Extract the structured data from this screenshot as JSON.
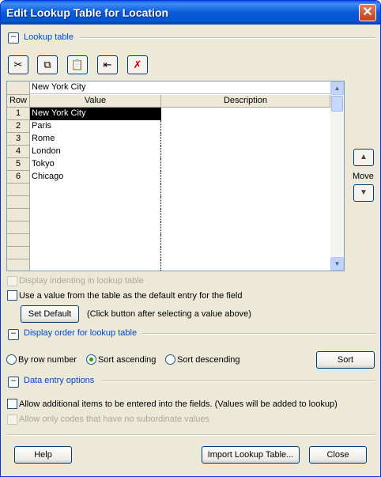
{
  "window": {
    "title": "Edit Lookup Table for Location",
    "close_glyph": "✕"
  },
  "sections": {
    "lookup_table": "Lookup table",
    "display_order": "Display order for lookup table",
    "data_entry": "Data entry options"
  },
  "toolbar": [
    {
      "name": "cut-icon",
      "glyph": "✂"
    },
    {
      "name": "copy-icon",
      "glyph": "⧉"
    },
    {
      "name": "paste-icon",
      "glyph": "📋"
    },
    {
      "name": "insert-row-icon",
      "glyph": "⇤"
    },
    {
      "name": "delete-row-icon",
      "glyph": "✗"
    }
  ],
  "grid": {
    "edit_value": "New York City",
    "columns": {
      "row": "Row",
      "value": "Value",
      "description": "Description"
    },
    "rows": [
      {
        "row": "1",
        "value": "New York City",
        "description": ""
      },
      {
        "row": "2",
        "value": "Paris",
        "description": ""
      },
      {
        "row": "3",
        "value": "Rome",
        "description": ""
      },
      {
        "row": "4",
        "value": "London",
        "description": ""
      },
      {
        "row": "5",
        "value": "Tokyo",
        "description": ""
      },
      {
        "row": "6",
        "value": "Chicago",
        "description": ""
      }
    ],
    "selected_row": 1
  },
  "move": {
    "label": "Move",
    "up_glyph": "▲",
    "down_glyph": "▼"
  },
  "options": {
    "display_indenting": {
      "label": "Display indenting in lookup table",
      "checked": false,
      "disabled": true
    },
    "use_default": {
      "label": "Use a value from the table as the default entry for the field",
      "checked": false
    },
    "set_default_button": "Set Default",
    "set_default_hint": "(Click button after selecting a value above)"
  },
  "order": {
    "by_row": "By row number",
    "ascending": "Sort ascending",
    "descending": "Sort descending",
    "selected": "ascending",
    "sort_button": "Sort"
  },
  "data_entry": {
    "allow_additional": "Allow additional items to be entered into the fields. (Values will be added to lookup)",
    "allow_only_codes": "Allow only codes that have no subordinate values"
  },
  "footer": {
    "help": "Help",
    "import": "Import Lookup Table...",
    "close": "Close"
  },
  "collapse_glyph": "–"
}
